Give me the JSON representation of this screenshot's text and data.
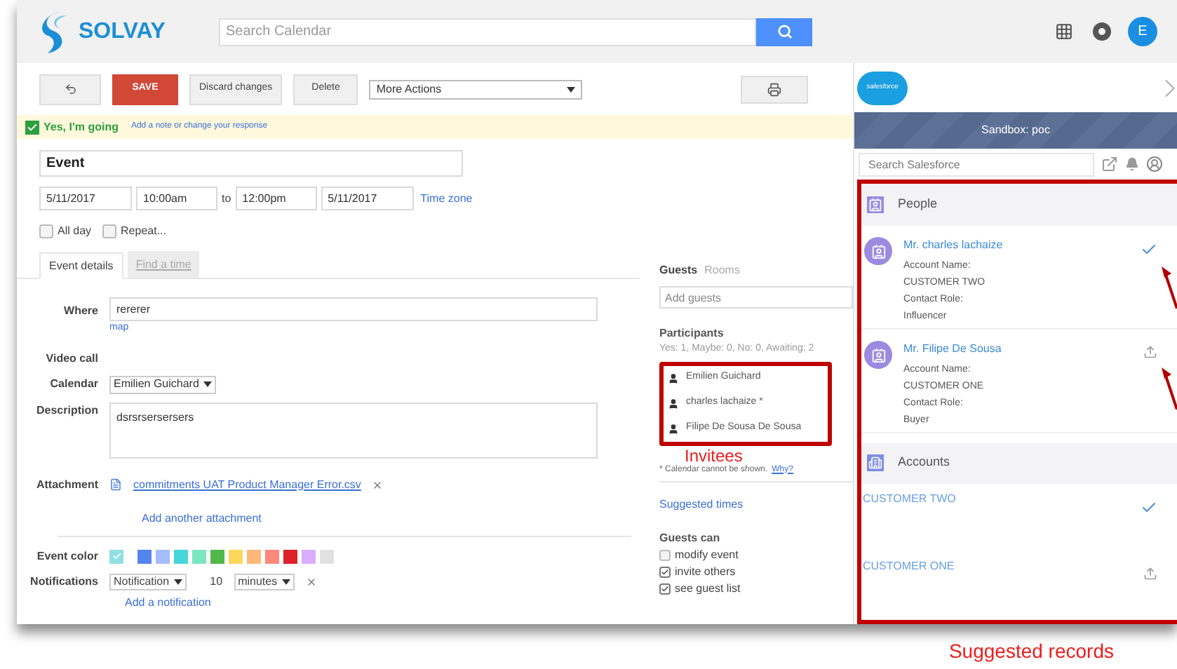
{
  "header": {
    "brand": "SOLVAY",
    "search": {
      "placeholder": "Search Calendar"
    },
    "avatar_initial": "E"
  },
  "toolbar": {
    "save": "SAVE",
    "discard": "Discard changes",
    "delete": "Delete",
    "more_actions": "More Actions"
  },
  "rsvp": {
    "checked": true,
    "label": "Yes, I'm going",
    "link": "Add a note or change your response"
  },
  "event": {
    "title": "Event",
    "start_date": "5/11/2017",
    "start_time": "10:00am",
    "to": "to",
    "end_time": "12:00pm",
    "end_date": "5/11/2017",
    "time_zone": "Time zone"
  },
  "options": [
    {
      "label": "All day",
      "checked": false
    },
    {
      "label": "Repeat...",
      "checked": false
    }
  ],
  "tabs": [
    {
      "label": "Event details",
      "selected": true
    },
    {
      "label": "Find a time",
      "selected": false
    }
  ],
  "form": {
    "where_label": "Where",
    "where": "rererer",
    "map": "map",
    "video_label": "Video call",
    "calendar_label": "Calendar",
    "calendar": "Emilien Guichard",
    "description_label": "Description",
    "description": "dsrsrsersersers",
    "attachment_label": "Attachment",
    "attachment": "commitments UAT Product Manager Error.csv",
    "add_attachment": "Add another attachment",
    "color_label": "Event color",
    "current": {
      "color": "#8fdfe3"
    },
    "swatches": [
      {
        "color": "#5484ed"
      },
      {
        "color": "#a4bdfc"
      },
      {
        "color": "#46d6db"
      },
      {
        "color": "#7ae7bf"
      },
      {
        "color": "#51b749"
      },
      {
        "color": "#fbd75b"
      },
      {
        "color": "#ffb878"
      },
      {
        "color": "#ff887c"
      },
      {
        "color": "#dc2127"
      },
      {
        "color": "#dbadff"
      },
      {
        "color": "#e1e1e1"
      }
    ],
    "notifications_label": "Notifications",
    "notification_type": "Notification",
    "notification_amount": "10",
    "notification_unit": "minutes",
    "add_notification": "Add a notification"
  },
  "guests": {
    "tabs": [
      {
        "label": "Guests",
        "selected": true
      },
      {
        "label": "Rooms",
        "selected": false
      }
    ],
    "add_placeholder": "Add guests",
    "participants_label": "Participants",
    "summary": "Yes: 1, Maybe: 0, No: 0, Awaiting: 2",
    "people": [
      {
        "name": "Emilien Guichard"
      },
      {
        "name": "charles lachaize *"
      },
      {
        "name": "Filipe De Sousa De Sousa"
      }
    ],
    "note": "* Calendar cannot be shown.",
    "why": "Why?",
    "suggested_times": "Suggested times",
    "can_label": "Guests can",
    "permissions": [
      {
        "label": "modify event",
        "checked": false
      },
      {
        "label": "invite others",
        "checked": true
      },
      {
        "label": "see guest list",
        "checked": true
      }
    ]
  },
  "salesforce": {
    "logo": "salesforce",
    "sandbox": "Sandbox: poc",
    "search_placeholder": "Search Salesforce",
    "people_label": "People",
    "people": [
      {
        "name": "Mr. charles lachaize",
        "fields": [
          "Account Name:",
          "CUSTOMER TWO",
          "Contact Role:",
          "Influencer"
        ],
        "kind": "check"
      },
      {
        "name": "Mr. Filipe De Sousa",
        "fields": [
          "Account Name:",
          "CUSTOMER ONE",
          "Contact Role:",
          "Buyer"
        ],
        "kind": "upload"
      }
    ],
    "accounts_label": "Accounts",
    "accounts": [
      {
        "name": "CUSTOMER TWO",
        "kind": "check"
      },
      {
        "name": "CUSTOMER ONE",
        "kind": "upload"
      }
    ]
  },
  "annotations": {
    "invitees": "Invitees",
    "suggested": "Suggested records"
  }
}
